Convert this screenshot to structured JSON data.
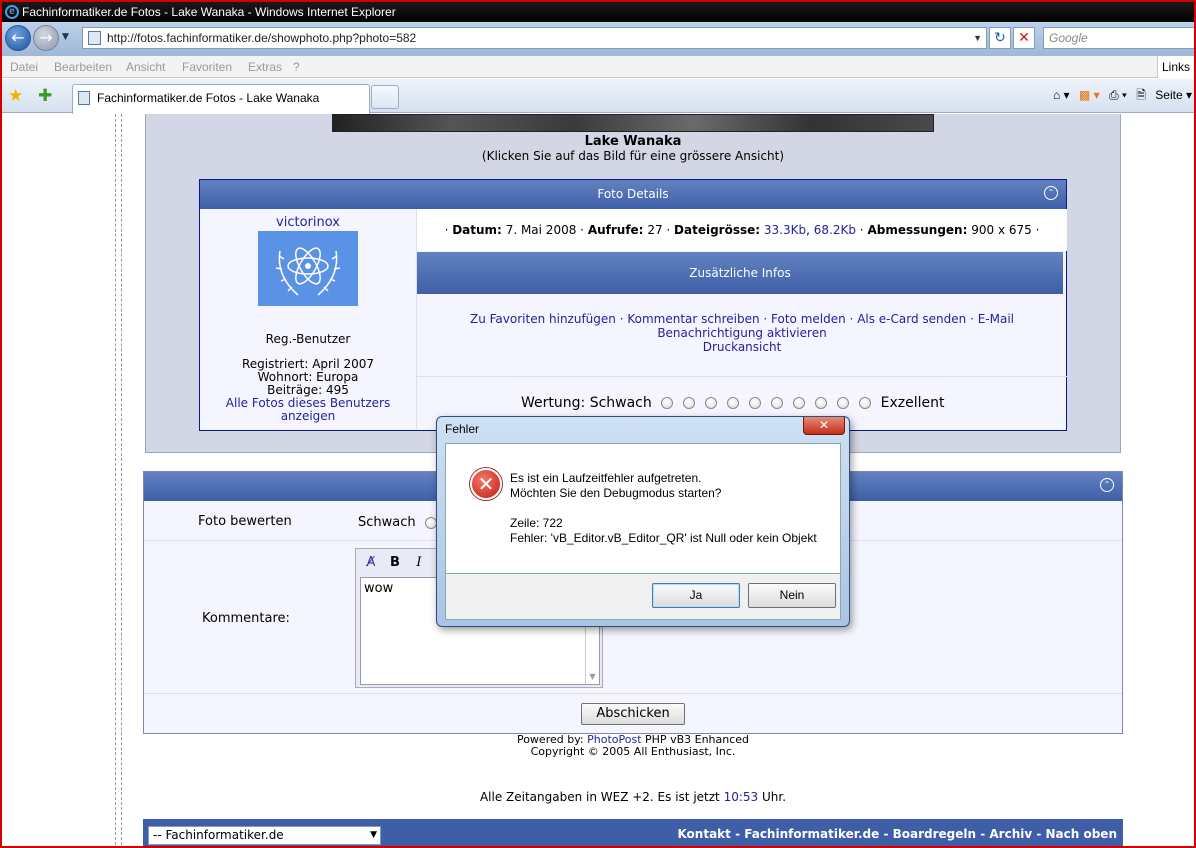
{
  "window": {
    "title": "Fachinformatiker.de Fotos - Lake Wanaka - Windows Internet Explorer"
  },
  "address": {
    "url": "http://fotos.fachinformatiker.de/showphoto.php?photo=582",
    "search_placeholder": "Google"
  },
  "menu": [
    "Datei",
    "Bearbeiten",
    "Ansicht",
    "Favoriten",
    "Extras",
    "?"
  ],
  "links_label": "Links",
  "tab": {
    "title": "Fachinformatiker.de Fotos - Lake Wanaka"
  },
  "command_bar": {
    "page_label": "Seite"
  },
  "photo": {
    "title": "Lake Wanaka",
    "hint": "(Klicken Sie auf das Bild für eine grössere Ansicht)"
  },
  "details": {
    "header": "Foto Details",
    "user": {
      "name": "victorinox",
      "role": "Reg.-Benutzer",
      "registered": "Registriert: April 2007",
      "location": "Wohnort: Europa",
      "posts": "Beiträge: 495",
      "all_photos": "Alle Fotos dieses Benutzers anzeigen"
    },
    "meta": {
      "date_label": "Datum:",
      "date": "7. Mai 2008",
      "views_label": "Aufrufe:",
      "views": "27",
      "size_label": "Dateigrösse:",
      "size1": "33.3Kb",
      "size2": "68.2Kb",
      "dim_label": "Abmessungen:",
      "dim": "900 x 675"
    },
    "extra_header": "Zusätzliche Infos",
    "actions": {
      "fav": "Zu Favoriten hinzufügen",
      "comment": "Kommentar schreiben",
      "report": "Foto melden",
      "ecard": "Als e-Card senden",
      "notify": "E-Mail Benachrichtigung aktivieren",
      "print": "Druckansicht"
    },
    "rating": {
      "label": "Wertung:",
      "low": "Schwach",
      "high": "Exzellent"
    }
  },
  "rate_form": {
    "label": "Foto bewerten",
    "low": "Schwach",
    "comment_label": "Kommentare:",
    "comment_text": "wow",
    "submit": "Abschicken"
  },
  "footer": {
    "powered_prefix": "Powered by:",
    "powered_link": "PhotoPost",
    "powered_suffix": "PHP vB3 Enhanced",
    "copyright": "Copyright © 2005 All Enthusiast, Inc.",
    "tz_prefix": "Alle Zeitangaben in WEZ +2. Es ist jetzt",
    "tz_time": "10:53",
    "tz_suffix": "Uhr."
  },
  "bottom": {
    "select": "-- Fachinformatiker.de",
    "links": "Kontakt - Fachinformatiker.de - Boardregeln - Archiv - Nach oben"
  },
  "dialog": {
    "title": "Fehler",
    "line1": "Es ist ein Laufzeitfehler aufgetreten.",
    "line2": "Möchten Sie den Debugmodus starten?",
    "line3": "Zeile: 722",
    "line4": "Fehler: 'vB_Editor.vB_Editor_QR' ist Null oder kein Objekt",
    "yes": "Ja",
    "no": "Nein"
  }
}
